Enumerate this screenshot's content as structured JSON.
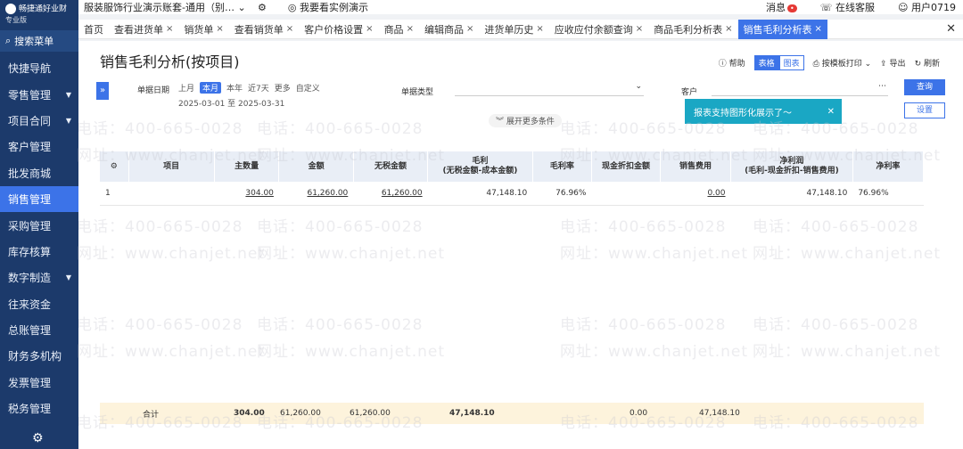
{
  "app": {
    "name": "畅捷通好业财",
    "edition": "专业版"
  },
  "topbar": {
    "account": "服装服饰行业演示账套-通用（别…",
    "demo_link": "我要看实例演示",
    "message": "消息",
    "online_service": "在线客服",
    "user": "用户0719"
  },
  "sidebar": {
    "search_label": "搜索菜单",
    "items": [
      {
        "label": "快捷导航",
        "caret": false
      },
      {
        "label": "零售管理",
        "caret": true
      },
      {
        "label": "项目合同",
        "caret": true
      },
      {
        "label": "客户管理",
        "caret": false
      },
      {
        "label": "批发商城",
        "caret": false
      },
      {
        "label": "销售管理",
        "caret": false,
        "active": true
      },
      {
        "label": "采购管理",
        "caret": false
      },
      {
        "label": "库存核算",
        "caret": false
      },
      {
        "label": "数字制造",
        "caret": true
      },
      {
        "label": "往来资金",
        "caret": false
      },
      {
        "label": "总账管理",
        "caret": false
      },
      {
        "label": "财务多机构",
        "caret": false
      },
      {
        "label": "发票管理",
        "caret": false
      },
      {
        "label": "税务管理",
        "caret": false
      }
    ]
  },
  "tabs": [
    {
      "label": "首页",
      "closable": false
    },
    {
      "label": "查看进货单",
      "closable": true
    },
    {
      "label": "销货单",
      "closable": true
    },
    {
      "label": "查看销货单",
      "closable": true
    },
    {
      "label": "客户价格设置",
      "closable": true
    },
    {
      "label": "商品",
      "closable": true
    },
    {
      "label": "编辑商品",
      "closable": true
    },
    {
      "label": "进货单历史",
      "closable": true
    },
    {
      "label": "应收应付余额查询",
      "closable": true
    },
    {
      "label": "商品毛利分析表",
      "closable": true
    },
    {
      "label": "销售毛利分析表",
      "closable": true,
      "active": true
    }
  ],
  "page": {
    "title": "销售毛利分析(按项目)",
    "help": "帮助",
    "view_table": "表格",
    "view_chart": "图表",
    "print": "按模板打印",
    "export": "导出",
    "refresh": "刷新"
  },
  "filter": {
    "date_label": "单据日期",
    "quick": [
      "上月",
      "本月",
      "本年",
      "近7天",
      "更多",
      "自定义"
    ],
    "active_quick": "本月",
    "date_range": "2025-03-01 至 2025-03-31",
    "doc_type_label": "单据类型",
    "customer_label": "客户",
    "more_conditions": "展开更多条件",
    "query_button": "查询",
    "settings_button": "设置"
  },
  "tooltip": {
    "text": "报表支持图形化展示了～"
  },
  "table": {
    "headers": [
      "项目",
      "主数量",
      "金额",
      "无税金额",
      "毛利\n(无税金额-成本金额)",
      "毛利率",
      "现金折扣金额",
      "销售费用",
      "净利润\n(毛利-现金折扣-销售费用)",
      "净利率"
    ],
    "rows": [
      {
        "index": "1",
        "project": "",
        "qty": "304.00",
        "amount": "61,260.00",
        "amount_ex_tax": "61,260.00",
        "gross_profit": "47,148.10",
        "gross_margin": "76.96%",
        "cash_discount": "",
        "sales_expense": "0.00",
        "net_profit": "47,148.10",
        "net_margin": "76.96%"
      }
    ],
    "total": {
      "label": "合计",
      "qty": "304.00",
      "amount": "61,260.00",
      "amount_ex_tax": "61,260.00",
      "gross_profit": "47,148.10",
      "sales_expense": "0.00",
      "net_profit": "47,148.10"
    }
  },
  "watermark": {
    "phone": "电话：400-665-0028",
    "site": "网址：www.chanjet.net"
  },
  "colors": {
    "sidebar": "#1c3a6b",
    "accent": "#3c73e8",
    "tooltip": "#1aa7c4"
  }
}
